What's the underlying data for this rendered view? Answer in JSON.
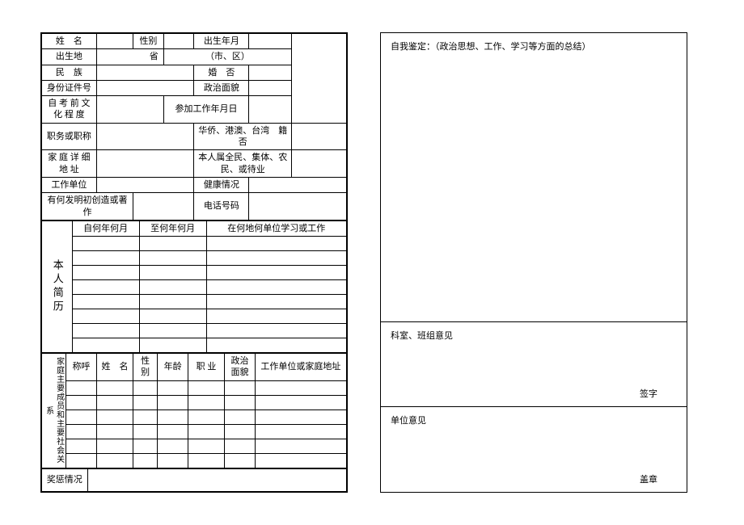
{
  "left": {
    "row1": {
      "name": "姓　名",
      "gender": "性别",
      "birth": "出生年月"
    },
    "row2": {
      "birthplace": "出生地",
      "province": "省",
      "city": "（市、区）"
    },
    "row3": {
      "ethnic": "民　族",
      "marriage": "婚　否"
    },
    "row4": {
      "idno": "身份证件号",
      "politics": "政治面貌"
    },
    "row5": {
      "edu": "自 考 前 文 化 程 度",
      "workdate": "参加工作年月日"
    },
    "row6": {
      "title": "职务或职称",
      "overseas": "华侨、港澳、台湾　籍　否"
    },
    "row7": {
      "addr": "家 庭 详 细 地 址",
      "employ": "本人属全民、集体、农民、或待业"
    },
    "row8": {
      "workunit": "工作单位",
      "health": "健康情况"
    },
    "row9": {
      "invention": "有何发明初创造或著作",
      "phone": "电话号码"
    },
    "resume": {
      "vlabel": "本人简历",
      "from": "自何年何月",
      "to": "至何年何月",
      "where": "在何地何单位学习或工作"
    },
    "family": {
      "vlabel": "家庭主要成员和主要社会关系",
      "relation": "称呼",
      "fname": "姓　名",
      "fgender": "性别",
      "age": "年龄",
      "job": "职 业",
      "fpolitics": "政治面貌",
      "funit": "工作单位或家庭地址"
    },
    "reward": "奖惩情况"
  },
  "right": {
    "self": "自我鉴定：（政治思想、工作、学习等方面的总结）",
    "dept": "科室、班组意见",
    "sign": "签字",
    "unit": "单位意见",
    "stamp": "盖章"
  }
}
